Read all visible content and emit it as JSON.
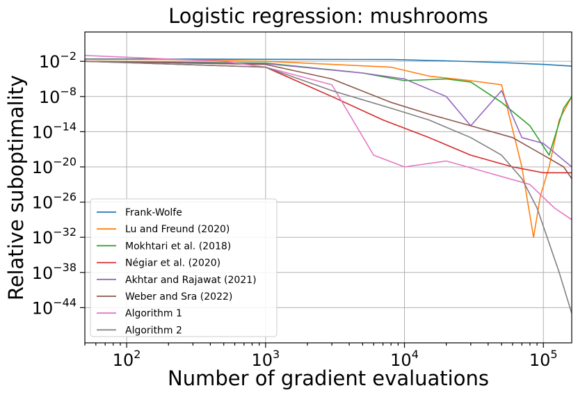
{
  "chart_data": {
    "type": "line",
    "title": "Logistic regression: mushrooms",
    "xlabel": "Number of gradient evaluations",
    "ylabel": "Relative suboptimality",
    "xscale": "log",
    "yscale": "log",
    "xlim": [
      50,
      160000
    ],
    "ylim": [
      1e-50,
      1000.0
    ],
    "grid": true,
    "legend_position": "lower-left",
    "x_ticks": [
      {
        "base": "10",
        "exp": "2",
        "value": 100
      },
      {
        "base": "10",
        "exp": "3",
        "value": 1000
      },
      {
        "base": "10",
        "exp": "4",
        "value": 10000
      },
      {
        "base": "10",
        "exp": "5",
        "value": 100000
      }
    ],
    "y_ticks": [
      {
        "base": "10",
        "exp": "−2",
        "value": 0.01
      },
      {
        "base": "10",
        "exp": "−8",
        "value": 1e-08
      },
      {
        "base": "10",
        "exp": "−14",
        "value": 1e-14
      },
      {
        "base": "10",
        "exp": "−20",
        "value": 1e-20
      },
      {
        "base": "10",
        "exp": "−26",
        "value": 1e-26
      },
      {
        "base": "10",
        "exp": "−32",
        "value": 1e-32
      },
      {
        "base": "10",
        "exp": "−38",
        "value": 1e-38
      },
      {
        "base": "10",
        "exp": "−44",
        "value": 1e-44
      }
    ],
    "series": [
      {
        "name": "Frank-Wolfe",
        "color": "#1f77b4",
        "x": [
          50,
          100,
          1000,
          8000,
          20000,
          50000,
          100000,
          160000
        ],
        "y": [
          0.025,
          0.025,
          0.022,
          0.02,
          0.012,
          0.006,
          0.003,
          0.0015
        ]
      },
      {
        "name": "Lu and Freund (2020)",
        "color": "#ff7f0e",
        "x": [
          50,
          200,
          1000,
          3000,
          8000,
          15000,
          30000,
          50000,
          70000,
          85000,
          95000,
          110000,
          130000,
          160000
        ],
        "y": [
          0.02,
          0.02,
          0.01,
          0.003,
          0.001,
          3e-05,
          5e-06,
          1e-06,
          1e-20,
          1e-32,
          1e-25,
          1e-20,
          1e-12,
          1e-08
        ]
      },
      {
        "name": "Mokhtari et al. (2018)",
        "color": "#2ca02c",
        "x": [
          50,
          1000,
          5000,
          10000,
          20000,
          30000,
          50000,
          80000,
          110000,
          140000,
          160000
        ],
        "y": [
          0.01,
          0.005,
          0.0001,
          5e-06,
          1e-05,
          3e-06,
          1e-09,
          1e-13,
          1e-18,
          1e-10,
          1e-08
        ]
      },
      {
        "name": "Négiar et al. (2020)",
        "color": "#d62728",
        "x": [
          50,
          1000,
          3000,
          7000,
          15000,
          30000,
          60000,
          100000,
          160000
        ],
        "y": [
          0.01,
          0.001,
          1e-08,
          1e-12,
          1e-15,
          1e-18,
          1e-20,
          1e-21,
          1e-21
        ]
      },
      {
        "name": "Akhtar and Rajawat (2021)",
        "color": "#9467bd",
        "x": [
          50,
          1000,
          5000,
          10000,
          20000,
          30000,
          50000,
          70000,
          100000,
          160000
        ],
        "y": [
          0.01,
          0.004,
          0.0001,
          1e-05,
          1e-08,
          1e-13,
          1e-07,
          1e-15,
          1e-16,
          1e-20
        ]
      },
      {
        "name": "Weber and Sra (2022)",
        "color": "#8c564b",
        "x": [
          50,
          1000,
          3000,
          8000,
          15000,
          30000,
          60000,
          100000,
          140000,
          160000
        ],
        "y": [
          0.01,
          0.003,
          1e-05,
          1e-09,
          1e-11,
          1e-13,
          1e-15,
          1e-18,
          1e-20,
          1e-22
        ]
      },
      {
        "name": "Algorithm 1",
        "color": "#e377c2",
        "x": [
          50,
          100,
          500,
          1000,
          3000,
          6000,
          10000,
          20000,
          40000,
          80000,
          120000,
          160000
        ],
        "y": [
          0.1,
          0.05,
          0.01,
          0.001,
          1e-06,
          1e-18,
          1e-20,
          1e-19,
          1e-21,
          1e-23,
          1e-27,
          1e-29
        ]
      },
      {
        "name": "Algorithm 2",
        "color": "#7f7f7f",
        "x": [
          50,
          1000,
          3000,
          8000,
          15000,
          30000,
          50000,
          70000,
          90000,
          110000,
          130000,
          160000
        ],
        "y": [
          0.01,
          0.001,
          1e-07,
          1e-10,
          1e-12,
          1e-15,
          1e-18,
          1e-22,
          1e-27,
          1e-33,
          1e-38,
          1e-45
        ]
      }
    ]
  }
}
